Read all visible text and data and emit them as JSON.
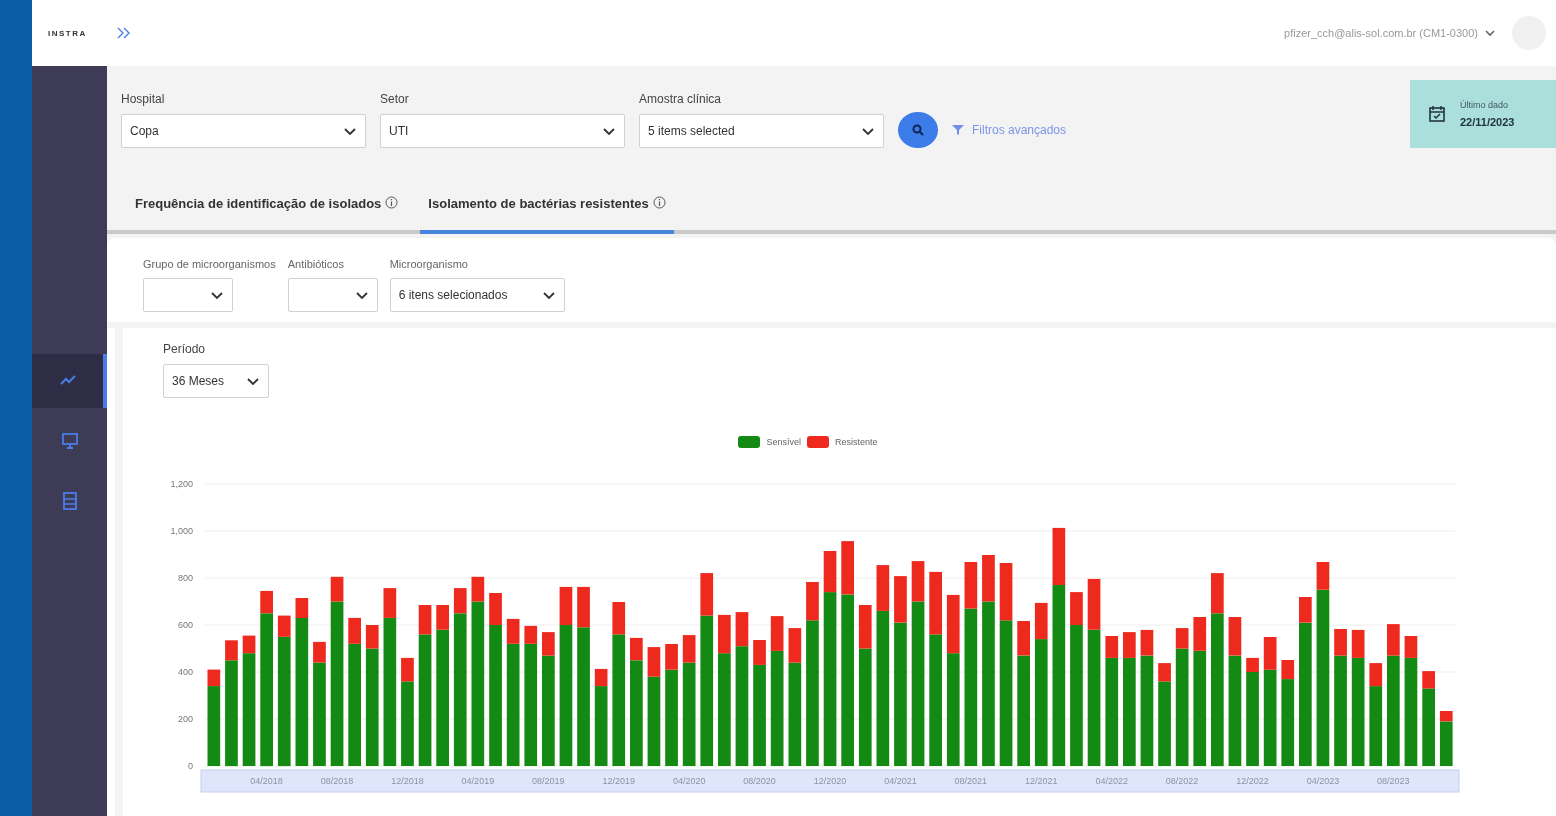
{
  "header": {
    "logo": "INSTRA",
    "user": "pfizer_cch@alis-sol.com.br (CM1-0300)"
  },
  "sidebar": {
    "items": [
      {
        "kind": "chart",
        "selected": true
      },
      {
        "kind": "monitor",
        "selected": false
      },
      {
        "kind": "database",
        "selected": false
      }
    ]
  },
  "filters": [
    {
      "label": "Hospital",
      "value": "Copa"
    },
    {
      "label": "Setor",
      "value": "UTI"
    },
    {
      "label": "Amostra clínica",
      "value": "5 items selected"
    }
  ],
  "advanced_filters": "Filtros avançados",
  "last_data": {
    "label": "Último dado",
    "value": "22/11/2023"
  },
  "tabs": [
    {
      "label": "Frequência de identificação de isolados",
      "selected": false
    },
    {
      "label": "Isolamento de bactérias resistentes",
      "selected": true
    }
  ],
  "sub_filters": [
    {
      "label": "Grupo de microorganismos"
    },
    {
      "label": "Antibióticos"
    },
    {
      "label": "Microorganismo",
      "value": "6 itens selecionados"
    }
  ],
  "period": {
    "label": "Período",
    "value": "36 Meses"
  },
  "chart_data": {
    "type": "bar",
    "stacked": true,
    "grid": true,
    "legend": true,
    "categories": [
      null,
      null,
      null,
      "04/2018",
      null,
      null,
      null,
      "08/2018",
      null,
      null,
      null,
      "12/2018",
      null,
      null,
      null,
      "04/2019",
      null,
      null,
      null,
      "08/2019",
      null,
      null,
      null,
      "12/2019",
      null,
      null,
      null,
      "04/2020",
      null,
      null,
      null,
      "08/2020",
      null,
      null,
      null,
      "12/2020",
      null,
      null,
      null,
      "04/2021",
      null,
      null,
      null,
      "08/2021",
      null,
      null,
      null,
      "12/2021",
      null,
      null,
      null,
      "04/2022",
      null,
      null,
      null,
      "08/2022",
      null,
      null,
      null,
      "12/2022",
      null,
      null,
      null,
      "04/2023",
      null,
      null,
      null,
      "08/2023",
      null,
      null,
      null
    ],
    "series": [
      {
        "name": "Sensível",
        "color": "#138a13",
        "values": [
          340,
          450,
          480,
          650,
          550,
          630,
          440,
          700,
          520,
          500,
          630,
          360,
          560,
          580,
          650,
          700,
          600,
          520,
          520,
          470,
          600,
          590,
          340,
          560,
          450,
          380,
          410,
          440,
          640,
          480,
          510,
          430,
          490,
          440,
          620,
          740,
          730,
          500,
          660,
          610,
          700,
          560,
          480,
          670,
          700,
          620,
          470,
          540,
          770,
          600,
          580,
          460,
          460,
          470,
          360,
          500,
          490,
          650,
          470,
          400,
          410,
          370,
          610,
          750,
          470,
          460,
          340,
          470,
          460,
          330,
          190
        ]
      },
      {
        "name": "Resistente",
        "color": "#ee2a1e",
        "values": [
          70,
          85,
          75,
          95,
          90,
          85,
          88,
          105,
          110,
          100,
          127,
          100,
          125,
          105,
          107,
          105,
          136,
          106,
          76,
          100,
          162,
          172,
          73,
          138,
          95,
          126,
          109,
          117,
          181,
          163,
          145,
          106,
          148,
          147,
          163,
          175,
          227,
          185,
          195,
          198,
          172,
          266,
          248,
          198,
          198,
          244,
          147,
          154,
          243,
          140,
          216,
          93,
          110,
          109,
          78,
          87,
          144,
          171,
          164,
          60,
          139,
          81,
          109,
          118,
          113,
          119,
          98,
          134,
          93,
          74,
          44
        ]
      }
    ],
    "yticks": [
      {
        "value": 0,
        "label": "0"
      },
      {
        "value": 200,
        "label": "200"
      },
      {
        "value": 400,
        "label": "400"
      },
      {
        "value": 600,
        "label": "600"
      },
      {
        "value": 800,
        "label": "800"
      },
      {
        "value": 1000,
        "label": "1,000"
      },
      {
        "value": 1200,
        "label": "1,200"
      }
    ],
    "ylim": [
      0,
      1200
    ]
  }
}
